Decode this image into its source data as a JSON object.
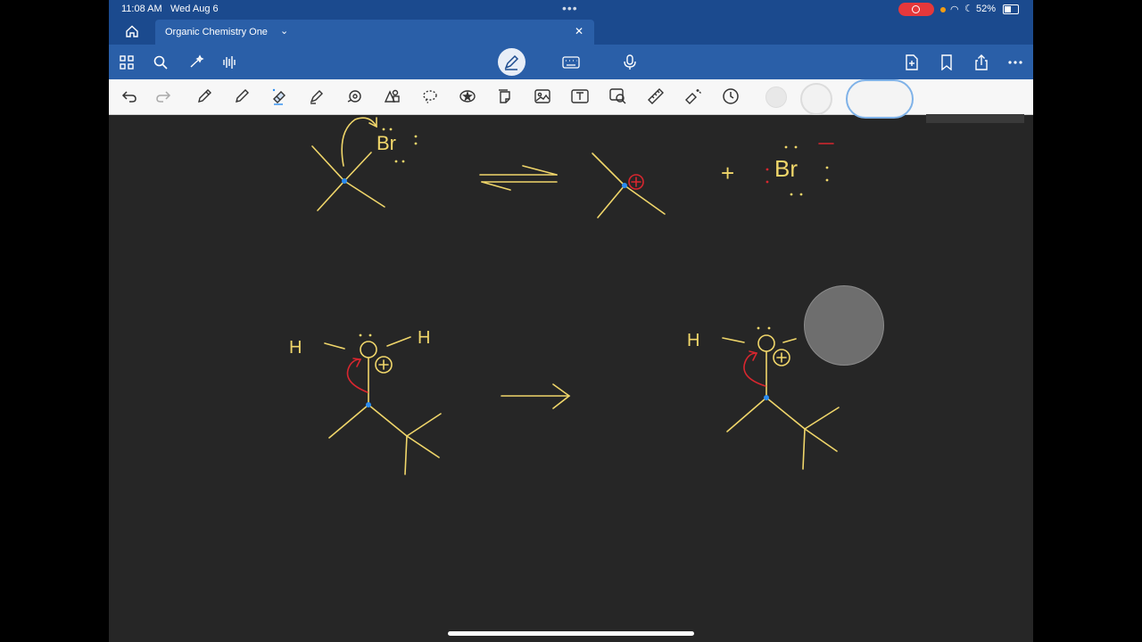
{
  "status": {
    "time": "11:08 AM",
    "date": "Wed Aug 6",
    "battery": "52%"
  },
  "tab": {
    "title": "Organic Chemistry One"
  },
  "icons": {
    "home": "home-icon",
    "close": "close-icon",
    "grid": "grid-icon",
    "search": "search-icon",
    "ai": "sparkle-icon",
    "audio": "waveform-icon",
    "pen_mode": "pen-mode-icon",
    "keyboard": "keyboard-icon",
    "mic": "microphone-icon",
    "add_page": "add-page-icon",
    "bookmark": "bookmark-icon",
    "share": "share-icon",
    "more": "more-icon"
  },
  "colors": {
    "ink_yellow": "#f0d66a",
    "ink_red": "#d8262f",
    "ink_blue": "#2b8cf0",
    "status_bg": "#1b4a8e",
    "toolbar_bg": "#2a5fa8"
  },
  "canvas": {
    "top_left_label": "Br",
    "top_right_label": "Br",
    "plus": "+",
    "h_labels": [
      "H",
      "H",
      "H"
    ]
  }
}
